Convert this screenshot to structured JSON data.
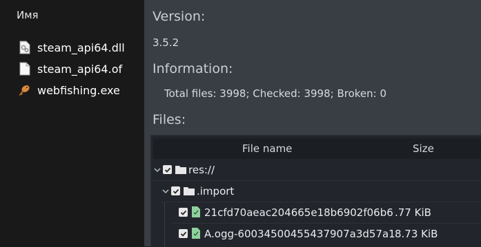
{
  "explorer": {
    "column_header": "Имя",
    "items": [
      {
        "label": "steam_api64.dll",
        "icon": "dll-file-icon"
      },
      {
        "label": "steam_api64.of",
        "icon": "blank-file-icon"
      },
      {
        "label": "webfishing.exe",
        "icon": "fish-app-icon"
      }
    ]
  },
  "panel": {
    "version_heading": "Version:",
    "version_value": "3.5.2",
    "information_heading": "Information:",
    "information_value": "Total files: 3998; Checked: 3998; Broken: 0",
    "files_heading": "Files:",
    "columns": {
      "name": "File name",
      "size": "Size"
    },
    "rows": [
      {
        "label": "res://",
        "size": "",
        "type": "folder"
      },
      {
        "label": ".import",
        "size": "",
        "type": "folder"
      },
      {
        "label": "21cfd70aeac204665e18b6902f06b6",
        "size": ".77 KiB",
        "type": "file"
      },
      {
        "label": "A.ogg-60034500455437907a3d57a1",
        "size": "8.73 KiB",
        "type": "file"
      }
    ]
  },
  "colors": {
    "explorer_bg": "#191919",
    "panel_bg": "#393e45",
    "tree_bg": "#22262c",
    "header_bg": "#1b1e23",
    "file_icon_green": "#8fd19e"
  }
}
